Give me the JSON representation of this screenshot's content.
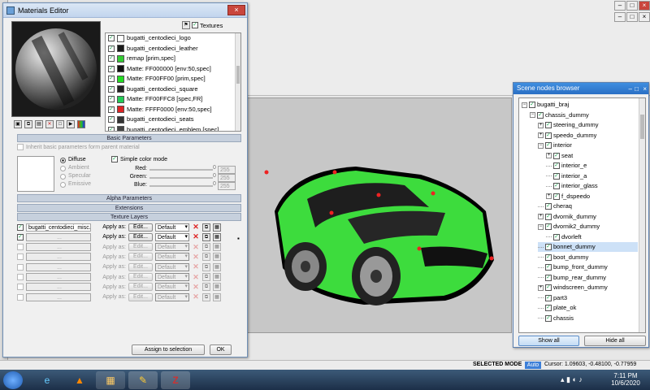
{
  "materials_editor": {
    "title": "Materials Editor",
    "textures_toggle": "Textures",
    "material_list": [
      {
        "label": "bugatti_centodieci_logo",
        "color": "#ffffff",
        "checked": true
      },
      {
        "label": "bugatti_centodieci_leather",
        "color": "#1a1a1a",
        "checked": true
      },
      {
        "label": "remap [prim,spec]",
        "color": "#33cc33",
        "checked": true
      },
      {
        "label": "Matte: FF000000 [env:50,spec]",
        "color": "#111111",
        "checked": true
      },
      {
        "label": "Matte: FF00FF00 [prim,spec]",
        "color": "#22dd22",
        "checked": true
      },
      {
        "label": "bugatti_centodieci_square",
        "color": "#222222",
        "checked": true
      },
      {
        "label": "Matte: FF00FFC8 [spec,FR]",
        "color": "#22cc55",
        "checked": true
      },
      {
        "label": "Matte: FFFF0000 [env:50,spec]",
        "color": "#dd2222",
        "checked": true
      },
      {
        "label": "bugatti_centodieci_seats",
        "color": "#333333",
        "checked": true
      },
      {
        "label": "bugatti_centodieci_emblem [spec]",
        "color": "#444444",
        "checked": true
      }
    ],
    "basic_parameters": {
      "header": "Basic Parameters",
      "inherit_label": "Inherit basic parameters form parent material",
      "mode_diffuse": "Diffuse",
      "mode_ambient": "Ambient",
      "mode_specular": "Specular",
      "mode_emissive": "Emissive",
      "simple_color_mode": "Simple color mode",
      "red_label": "Red:",
      "green_label": "Green:",
      "blue_label": "Blue:",
      "red_value": "255",
      "green_value": "255",
      "blue_value": "255",
      "slider_zero": "0"
    },
    "alpha_parameters": "Alpha Parameters",
    "extensions": "Extensions",
    "texture_layers": {
      "header": "Texture Layers",
      "apply_as": "Apply as:",
      "edit": "Edit...",
      "default": "Default",
      "empty": "...",
      "layers": [
        {
          "name": "bugatti_centodieci_misc.bmp",
          "enabled": true
        },
        {
          "name": "...",
          "enabled": true
        },
        {
          "name": "...",
          "enabled": false
        },
        {
          "name": "...",
          "enabled": false
        },
        {
          "name": "...",
          "enabled": false
        },
        {
          "name": "...",
          "enabled": false
        },
        {
          "name": "...",
          "enabled": false
        },
        {
          "name": "...",
          "enabled": false
        }
      ]
    },
    "assign_button": "Assign to selection",
    "ok_button": "OK"
  },
  "scene_browser": {
    "title": "Scene nodes browser",
    "nodes": [
      {
        "label": "bugatti_braj",
        "depth": 0,
        "exp": "−",
        "checked": true
      },
      {
        "label": "chassis_dummy",
        "depth": 1,
        "exp": "−",
        "checked": true
      },
      {
        "label": "steering_dummy",
        "depth": 2,
        "exp": "+",
        "checked": true
      },
      {
        "label": "speedo_dummy",
        "depth": 2,
        "exp": "+",
        "checked": true
      },
      {
        "label": "interior",
        "depth": 2,
        "exp": "−",
        "checked": true
      },
      {
        "label": "seat",
        "depth": 3,
        "exp": "+",
        "checked": true
      },
      {
        "label": "interior_e",
        "depth": 3,
        "exp": "",
        "checked": true
      },
      {
        "label": "interior_a",
        "depth": 3,
        "exp": "",
        "checked": true
      },
      {
        "label": "interior_glass",
        "depth": 3,
        "exp": "",
        "checked": true
      },
      {
        "label": "f_dspeedo",
        "depth": 3,
        "exp": "+",
        "checked": true
      },
      {
        "label": "cheraq",
        "depth": 2,
        "exp": "",
        "checked": true
      },
      {
        "label": "dvornik_dummy",
        "depth": 2,
        "exp": "+",
        "checked": true
      },
      {
        "label": "dvornik2_dummy",
        "depth": 2,
        "exp": "−",
        "checked": true
      },
      {
        "label": "dvorleft",
        "depth": 3,
        "exp": "",
        "checked": true
      },
      {
        "label": "bonnet_dummy",
        "depth": 2,
        "exp": "",
        "checked": true,
        "selected": true
      },
      {
        "label": "boot_dummy",
        "depth": 2,
        "exp": "",
        "checked": true
      },
      {
        "label": "bump_front_dummy",
        "depth": 2,
        "exp": "",
        "checked": true
      },
      {
        "label": "bump_rear_dummy",
        "depth": 2,
        "exp": "",
        "checked": true
      },
      {
        "label": "windscreen_dummy",
        "depth": 2,
        "exp": "+",
        "checked": true
      },
      {
        "label": "part3",
        "depth": 2,
        "exp": "",
        "checked": true
      },
      {
        "label": "plate_ok",
        "depth": 2,
        "exp": "",
        "checked": true
      },
      {
        "label": "chassis",
        "depth": 2,
        "exp": "",
        "checked": true
      }
    ],
    "show_all": "Show all",
    "hide_all": "Hide all"
  },
  "status": {
    "mode": "SELECTED MODE",
    "auto": "Auto",
    "cursor": "Cursor: 1.09603, -0.48100, -0.77959"
  },
  "taskbar": {
    "time": "7:11 PM",
    "date": "10/6/2020"
  },
  "colors": {
    "car_body": "#3ddc3d",
    "car_dark": "#1e1e1e",
    "viewport_bg": "#c7c7c7"
  }
}
